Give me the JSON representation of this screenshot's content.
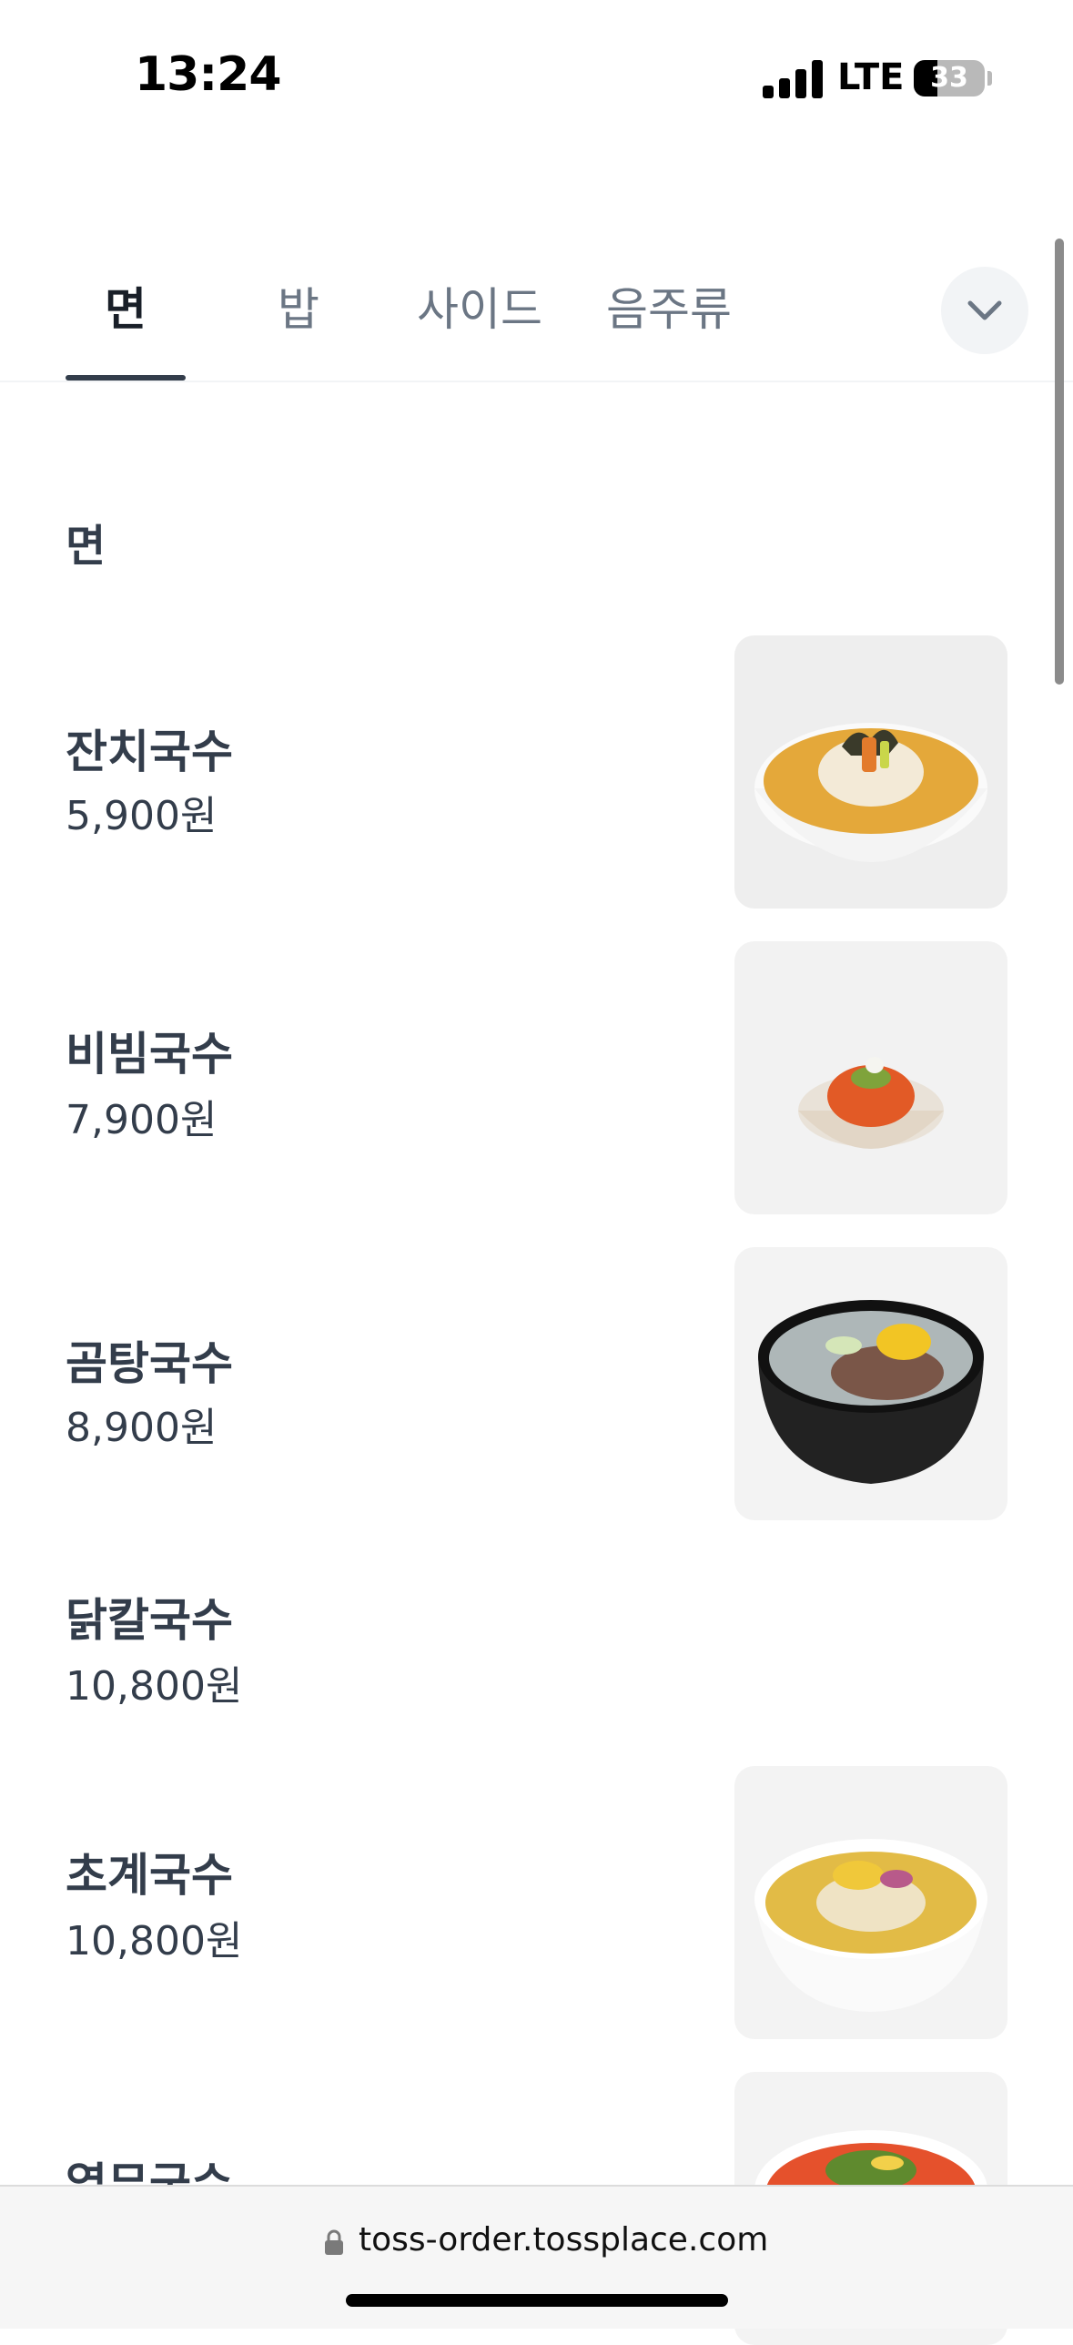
{
  "status_bar": {
    "time": "13:24",
    "network": "LTE",
    "battery_level": "33"
  },
  "tabs": [
    {
      "label": "면",
      "active": true
    },
    {
      "label": "밥",
      "active": false
    },
    {
      "label": "사이드",
      "active": false
    },
    {
      "label": "음주류",
      "active": false
    }
  ],
  "section": {
    "title": "면"
  },
  "menu_items": [
    {
      "name": "잔치국수",
      "price": "5,900원",
      "image": "janchi-guksu-photo"
    },
    {
      "name": "비빔국수",
      "price": "7,900원",
      "image": "bibim-guksu-photo"
    },
    {
      "name": "곰탕국수",
      "price": "8,900원",
      "image": "gomtang-guksu-photo"
    },
    {
      "name": "닭칼국수",
      "price": "10,800원",
      "image": null
    },
    {
      "name": "초계국수",
      "price": "10,800원",
      "image": "chogye-guksu-photo"
    },
    {
      "name": "열무국수",
      "price": "",
      "image": "yeolmu-guksu-photo"
    }
  ],
  "url_bar": {
    "url": "toss-order.tossplace.com"
  },
  "colors": {
    "text_primary": "#333d4b",
    "text_secondary": "#6b7684",
    "divider": "#f2f4f6"
  }
}
